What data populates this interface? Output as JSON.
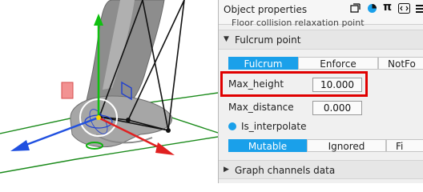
{
  "panel": {
    "title": "Object properties",
    "toolbar_icons": [
      "tag-icon",
      "palette-icon",
      "pi-icon",
      "code-icon",
      "menu-icon"
    ],
    "pi_glyph": "π",
    "clipped_text": "Floor collision relaxation point",
    "sections": {
      "fulcrum": {
        "label": "Fulcrum point",
        "expanded": true
      },
      "graph": {
        "label": "Graph channels data",
        "expanded": false
      }
    },
    "mode_tabs": [
      {
        "label": "Fulcrum",
        "active": true
      },
      {
        "label": "Enforce",
        "active": false
      },
      {
        "label": "NotFo",
        "active": false
      }
    ],
    "max_height": {
      "label": "Max_height",
      "value": "10.000"
    },
    "max_distance": {
      "label": "Max_distance",
      "value": "0.000"
    },
    "is_interpolate": {
      "label": "Is_interpolate",
      "checked": true
    },
    "state_tabs": [
      {
        "label": "Mutable",
        "active": true
      },
      {
        "label": "Ignored",
        "active": false
      },
      {
        "label": "Fi",
        "active": false
      }
    ]
  },
  "colors": {
    "accent": "#1aa0ea",
    "highlight": "#e00000",
    "axis_x": "#e02020",
    "axis_y": "#10c010",
    "axis_z": "#2050e0",
    "ground": "#1a8a1a"
  }
}
